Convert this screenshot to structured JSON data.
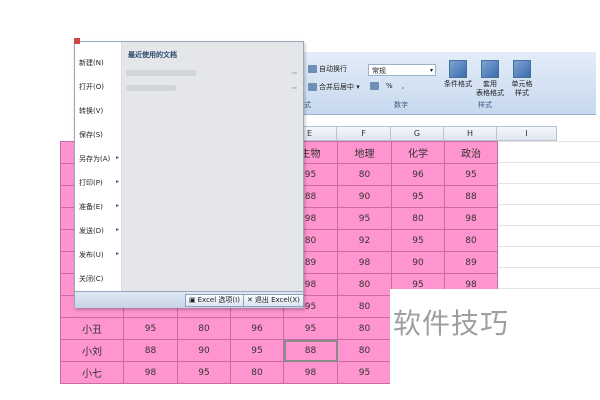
{
  "ribbon": {
    "auto_wrap": "自动换行",
    "merge_center": "合并后居中 ▾",
    "number_format": "常规",
    "percent": "%",
    "comma": ",",
    "conditional_format": "条件格式",
    "table_format_line1": "套用",
    "table_format_line2": "表格格式",
    "cell_style_line1": "单元格",
    "cell_style_line2": "样式",
    "group_alignment": "式",
    "group_number": "数字",
    "group_styles": "样式"
  },
  "columns": [
    "E",
    "F",
    "G",
    "H",
    "I"
  ],
  "table": {
    "header": [
      "",
      "",
      "",
      "",
      "生物",
      "地理",
      "化学",
      "政治"
    ],
    "rows": [
      [
        "",
        "",
        "",
        "",
        "95",
        "80",
        "96",
        "95"
      ],
      [
        "",
        "",
        "",
        "",
        "88",
        "90",
        "95",
        "88"
      ],
      [
        "",
        "",
        "",
        "",
        "98",
        "95",
        "80",
        "98"
      ],
      [
        "",
        "",
        "",
        "",
        "80",
        "92",
        "95",
        "80"
      ],
      [
        "",
        "",
        "",
        "",
        "89",
        "98",
        "90",
        "89"
      ],
      [
        "",
        "",
        "",
        "",
        "98",
        "80",
        "95",
        "98"
      ],
      [
        "",
        "",
        "",
        "",
        "95",
        "80",
        "95",
        "95"
      ],
      [
        "小丑",
        "95",
        "80",
        "96",
        "95",
        "80",
        "",
        ""
      ],
      [
        "小刘",
        "88",
        "90",
        "95",
        "88",
        "80",
        "",
        ""
      ],
      [
        "小七",
        "98",
        "95",
        "80",
        "98",
        "95",
        "",
        ""
      ]
    ]
  },
  "menu": {
    "items": [
      {
        "label": "新建(N)",
        "submenu": false
      },
      {
        "label": "打开(O)",
        "submenu": false
      },
      {
        "label": "转换(V)",
        "submenu": false
      },
      {
        "label": "保存(S)",
        "submenu": false
      },
      {
        "label": "另存为(A)",
        "submenu": true
      },
      {
        "label": "打印(P)",
        "submenu": true
      },
      {
        "label": "准备(E)",
        "submenu": true
      },
      {
        "label": "发送(D)",
        "submenu": true
      },
      {
        "label": "发布(U)",
        "submenu": true
      },
      {
        "label": "关闭(C)",
        "submenu": false
      }
    ],
    "recent_title": "最近使用的文档",
    "excel_options": "Excel 选项(I)",
    "exit_excel": "退出 Excel(X)"
  },
  "watermark": "软件技巧",
  "colors": {
    "cell_fill": "#ff95cf",
    "cell_border": "#c96aa6"
  }
}
